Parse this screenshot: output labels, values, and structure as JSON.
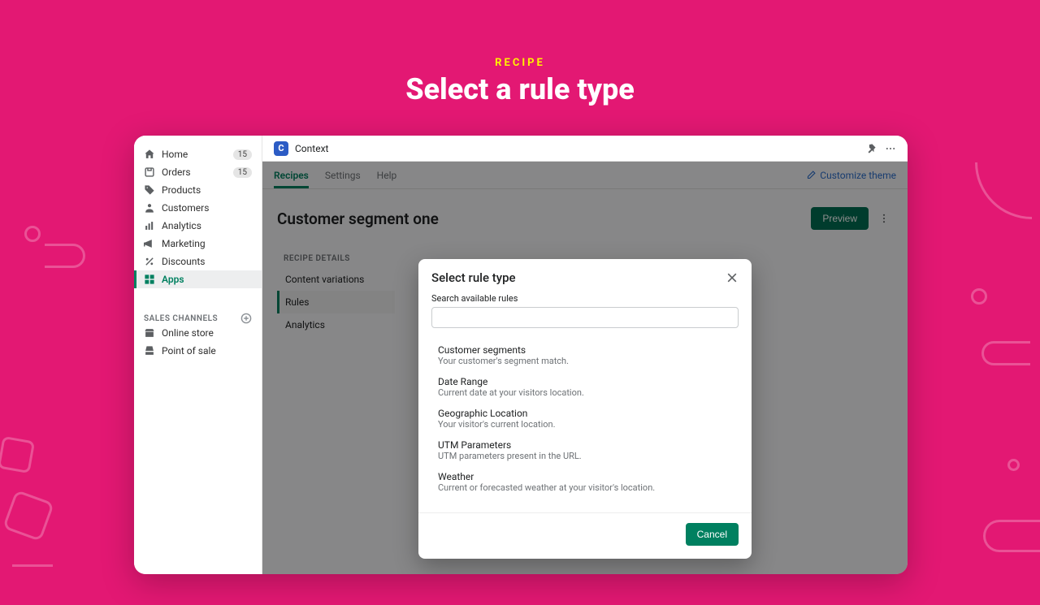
{
  "hero": {
    "eyebrow": "RECIPE",
    "title": "Select a rule type"
  },
  "sidebar": {
    "items": [
      {
        "label": "Home",
        "badge": "15"
      },
      {
        "label": "Orders",
        "badge": "15"
      },
      {
        "label": "Products"
      },
      {
        "label": "Customers"
      },
      {
        "label": "Analytics"
      },
      {
        "label": "Marketing"
      },
      {
        "label": "Discounts"
      },
      {
        "label": "Apps"
      }
    ],
    "channels_header": "SALES CHANNELS",
    "channels": [
      {
        "label": "Online store"
      },
      {
        "label": "Point of sale"
      }
    ]
  },
  "topbar": {
    "app_name": "Context"
  },
  "tabs": {
    "items": [
      "Recipes",
      "Settings",
      "Help"
    ],
    "active": "Recipes",
    "customize": "Customize theme"
  },
  "page": {
    "title": "Customer segment one",
    "preview": "Preview",
    "details_header": "RECIPE DETAILS",
    "details": [
      "Content variations",
      "Rules",
      "Analytics"
    ],
    "details_active": "Rules"
  },
  "modal": {
    "title": "Select rule type",
    "search_label": "Search available rules",
    "cancel": "Cancel",
    "rules": [
      {
        "title": "Customer segments",
        "desc": "Your customer's segment match."
      },
      {
        "title": "Date Range",
        "desc": "Current date at your visitors location."
      },
      {
        "title": "Geographic Location",
        "desc": "Your visitor's current location."
      },
      {
        "title": "UTM Parameters",
        "desc": "UTM parameters present in the URL."
      },
      {
        "title": "Weather",
        "desc": "Current or forecasted weather at your visitor's location."
      }
    ]
  }
}
